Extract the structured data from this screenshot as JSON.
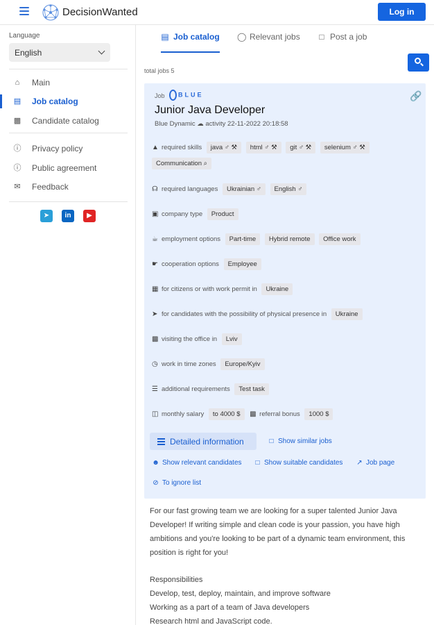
{
  "header": {
    "brand": "DecisionWanted",
    "login_label": "Log in"
  },
  "sidebar": {
    "language_label": "Language",
    "language_value": "English",
    "nav": [
      {
        "label": "Main",
        "icon": "home-icon"
      },
      {
        "label": "Job catalog",
        "icon": "job-catalog-icon",
        "active": true
      },
      {
        "label": "Candidate catalog",
        "icon": "candidate-catalog-icon"
      },
      {
        "label": "Privacy policy",
        "icon": "info-icon"
      },
      {
        "label": "Public agreement",
        "icon": "info-icon"
      },
      {
        "label": "Feedback",
        "icon": "mail-icon"
      }
    ],
    "social": [
      "telegram-icon",
      "linkedin-icon",
      "youtube-icon"
    ]
  },
  "tabs": [
    {
      "label": "Job catalog",
      "icon": "job-catalog-icon",
      "active": true
    },
    {
      "label": "Relevant jobs",
      "icon": "bulb-icon"
    },
    {
      "label": "Post a job",
      "icon": "document-icon"
    }
  ],
  "total": "total jobs 5",
  "job": {
    "job_label": "Job",
    "logo_text": "BLUE",
    "title": "Junior Java Developer",
    "meta": "Blue Dynamic ☁ activity 22-11-2022 20:18:58",
    "rows": {
      "skills_label": "required skills",
      "skills": [
        "java ♂ ⚒",
        "html ♂ ⚒",
        "git ♂ ⚒",
        "selenium ♂ ⚒",
        "Communication ⌕"
      ],
      "languages_label": "required languages",
      "languages": [
        "Ukrainian ♂",
        "English ♂"
      ],
      "company_type_label": "company type",
      "company_type": "Product",
      "employment_label": "employment options",
      "employment": [
        "Part-time",
        "Hybrid remote",
        "Office work"
      ],
      "cooperation_label": "cooperation options",
      "cooperation": "Employee",
      "citizens_label": "for citizens or with work permit in",
      "citizens": "Ukraine",
      "presence_label": "for candidates with the possibility of physical presence in",
      "presence": "Ukraine",
      "office_label": "visiting the office in",
      "office": "Lviv",
      "timezones_label": "work in time zones",
      "timezones": "Europe/Kyiv",
      "additional_label": "additional requirements",
      "additional": "Test task",
      "salary_label": "monthly salary",
      "salary": "to 4000  $",
      "bonus_label": "referral bonus",
      "bonus": "1000  $"
    },
    "actions": {
      "detailed": "Detailed information",
      "similar": "Show similar jobs",
      "relevant_candidates": "Show relevant candidates",
      "suitable_candidates": "Show suitable candidates",
      "job_page": "Job page",
      "ignore": "To ignore list"
    }
  },
  "description": {
    "intro": "For our fast growing team we are looking for a super talented Junior Java Developer! If writing simple and clean code is your passion, you have high ambitions and you're looking to be part of a dynamic team environment, this position is right for you!",
    "responsibilities_title": "Responsibilities",
    "responsibilities": [
      "Develop, test, deploy, maintain, and improve software",
      "Working as a part of a team of Java developers",
      "Research html and JavaScript code."
    ]
  }
}
